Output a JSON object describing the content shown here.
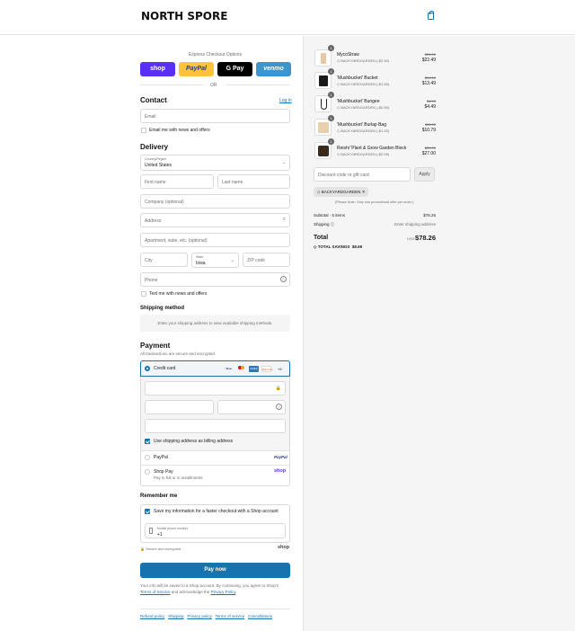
{
  "header": {
    "logo_text": "NORTH SPORE",
    "cart_icon": "shopping-bag-icon",
    "accent": "#1773b0"
  },
  "express": {
    "title": "Express Checkout Options",
    "buttons": [
      {
        "label": "shop",
        "color": "#5a31f4"
      },
      {
        "label": "PayPal",
        "color": "#ffc439"
      },
      {
        "label": "G Pay",
        "color": "#000000"
      },
      {
        "label": "venmo",
        "color": "#3d95ce"
      }
    ],
    "or": "OR"
  },
  "contact": {
    "title": "Contact",
    "login": "Log in",
    "email_placeholder": "Email",
    "news_label": "Email me with news and offers"
  },
  "delivery": {
    "title": "Delivery",
    "country_label": "Country/Region",
    "country_value": "United States",
    "first_name": "First name",
    "last_name": "Last name",
    "company": "Company (optional)",
    "address": "Address",
    "apartment": "Apartment, suite, etc. (optional)",
    "city": "City",
    "state_label": "State",
    "state_value": "Iowa",
    "zip": "ZIP code",
    "phone": "Phone",
    "text_label": "Text me with news and offers"
  },
  "shipping": {
    "title": "Shipping method",
    "message": "Enter your shipping address to view available shipping methods."
  },
  "payment": {
    "title": "Payment",
    "subtitle": "All transactions are secure and encrypted.",
    "credit_card": "Credit card",
    "card_brands": [
      "Visa",
      "Mastercard",
      "AMEX",
      "Discover",
      "+5"
    ],
    "billing_label": "Use shipping address as billing address",
    "paypal": "PayPal",
    "paypal_logo": "PayPal",
    "shop_pay": "Shop Pay",
    "shop_pay_sub": "Pay in full or in installments",
    "shop_logo": "shop"
  },
  "remember": {
    "title": "Remember me",
    "save_label": "Save my information for a faster checkout with a Shop account",
    "phone_label": "Mobile phone number",
    "phone_value": "+1",
    "secure": "Secure and encrypted",
    "shop_logo": "shop"
  },
  "pay_now": "Pay now",
  "legal": {
    "text1": "Your info will be saved to a Shop account. By continuing, you agree to Shop's",
    "terms": "Terms of Service",
    "text2": "and acknowledge the",
    "privacy": "Privacy Policy",
    "end": "."
  },
  "footer_links": [
    "Refund policy",
    "Shipping",
    "Privacy policy",
    "Terms of service",
    "Cancellations"
  ],
  "cart": {
    "items": [
      {
        "name": "MycoStraw",
        "code": "BACKYARDGARDEN (-$2.50)",
        "qty": "1",
        "original": "$24.99",
        "price": "$22.49"
      },
      {
        "name": "'Mushbucket' Bucket",
        "code": "BACKYARDGARDEN (-$1.50)",
        "qty": "1",
        "original": "$14.99",
        "price": "$13.49"
      },
      {
        "name": "'Mushbucket' Bungee",
        "code": "BACKYARDGARDEN (-$0.50)",
        "qty": "1",
        "original": "$4.99",
        "price": "$4.49"
      },
      {
        "name": "'Mushbucket' Burlap Bag",
        "code": "BACKYARDGARDEN (-$1.20)",
        "qty": "1",
        "original": "$11.99",
        "price": "$10.79"
      },
      {
        "name": "Reishi 'Plant & Grow Garden Block",
        "code": "BACKYARDGARDEN (-$2.99)",
        "qty": "1",
        "original": "$29.99",
        "price": "$27.00"
      }
    ],
    "discount_placeholder": "Discount code or gift card",
    "apply": "Apply",
    "applied_code": "BACKYARDGARDEN",
    "note": "(Please Note: Only one promotional offer per order.)",
    "subtotal_label": "Subtotal · 5 items",
    "subtotal_value": "$78.26",
    "shipping_label": "Shipping",
    "shipping_value": "Enter shipping address",
    "total_label": "Total",
    "currency": "USD",
    "total_value": "$78.26",
    "savings_label": "TOTAL SAVINGS",
    "savings_value": "$8.69"
  }
}
